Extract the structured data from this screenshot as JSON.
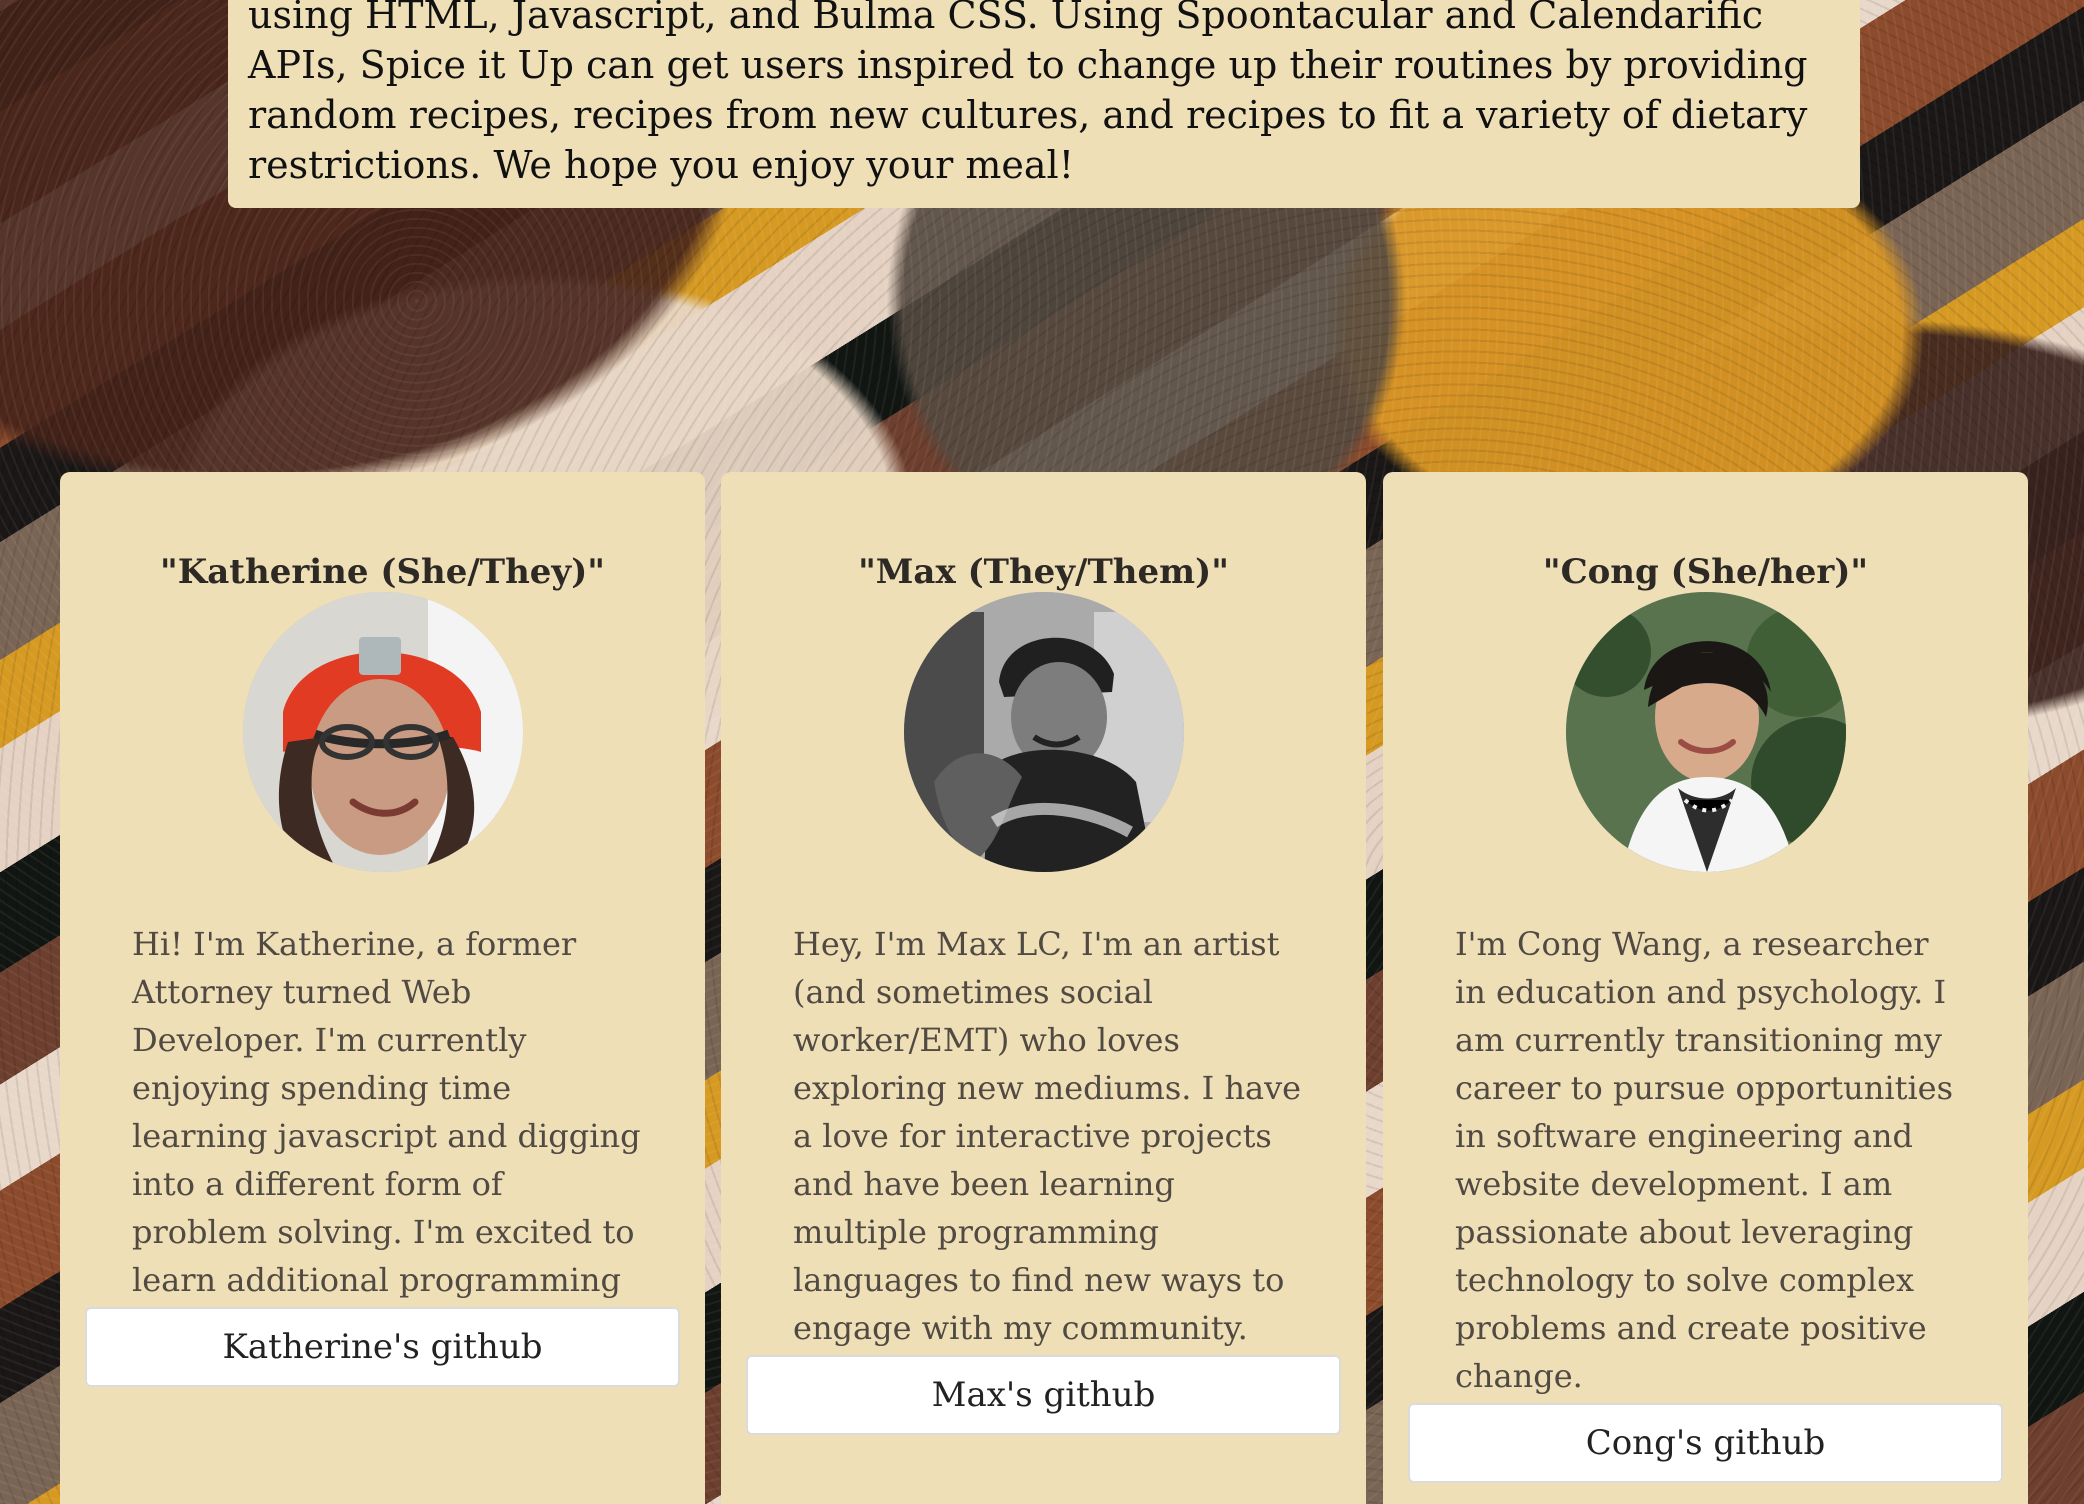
{
  "intro": {
    "text": "using HTML, Javascript, and Bulma CSS. Using Spoontacular and Calendarific APIs, Spice it Up can get users inspired to change up their routines by providing random recipes, recipes from new cultures, and recipes to fit a variety of dietary restrictions. We hope you enjoy your meal!"
  },
  "team": [
    {
      "name": "\"Katherine (She/They)\"",
      "bio": "Hi! I'm Katherine, a former Attorney turned Web Developer. I'm currently enjoying spending time learning javascript and digging into a different form of problem solving. I'm excited to learn additional programming languages.",
      "github_label": "Katherine's github"
    },
    {
      "name": "\"Max (They/Them)\"",
      "bio": "Hey, I'm Max LC, I'm an artist (and sometimes social worker/EMT) who loves exploring new mediums. I have a love for interactive projects and have been learning multiple programming languages to find new ways to engage with my community.",
      "github_label": "Max's github"
    },
    {
      "name": "\"Cong (She/her)\"",
      "bio": "I'm Cong Wang, a researcher in education and psychology. I am currently transitioning my career to pursue opportunities in software engineering and website development. I am passionate about leveraging technology to solve complex problems and create positive change.",
      "github_label": "Cong's github"
    }
  ],
  "colors": {
    "card_background": "#efdfb7",
    "button_background": "#ffffff",
    "text": "#504a43"
  }
}
